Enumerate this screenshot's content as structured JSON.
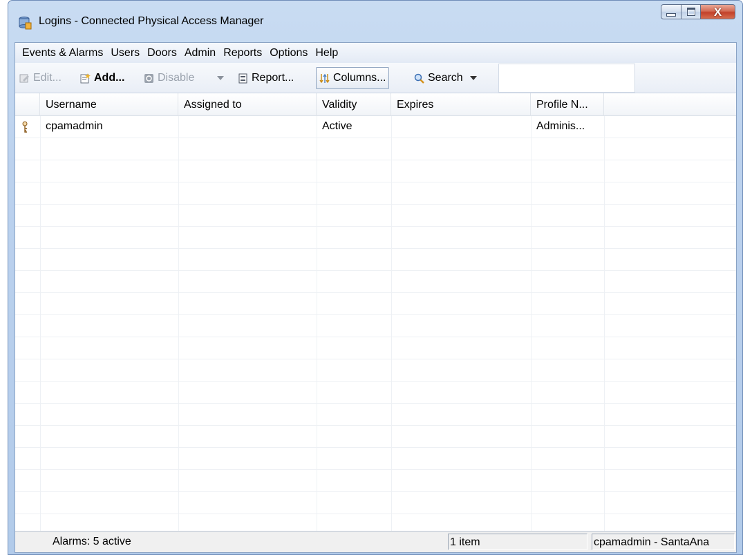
{
  "window": {
    "title": "Logins - Connected Physical Access Manager",
    "close_glyph": "X"
  },
  "menubar": {
    "items": [
      "Events & Alarms",
      "Users",
      "Doors",
      "Admin",
      "Reports",
      "Options",
      "Help"
    ]
  },
  "toolbar": {
    "edit_label": "Edit...",
    "add_label": "Add...",
    "disable_label": "Disable",
    "report_label": "Report...",
    "columns_label": "Columns...",
    "search_label": "Search",
    "search_value": ""
  },
  "table": {
    "columns": [
      "Username",
      "Assigned to",
      "Validity",
      "Expires",
      "Profile N..."
    ],
    "rows": [
      {
        "icon": "key-icon",
        "username": "cpamadmin",
        "assigned_to": "",
        "validity": "Active",
        "expires": "",
        "profile": "Adminis..."
      }
    ]
  },
  "statusbar": {
    "alarms": "Alarms: 5 active",
    "count": "1 item",
    "user": "cpamadmin - SantaAna"
  },
  "colors": {
    "frame": "#bcd2ee",
    "close_button": "#c2402a",
    "accent": "#4a7fc1"
  }
}
